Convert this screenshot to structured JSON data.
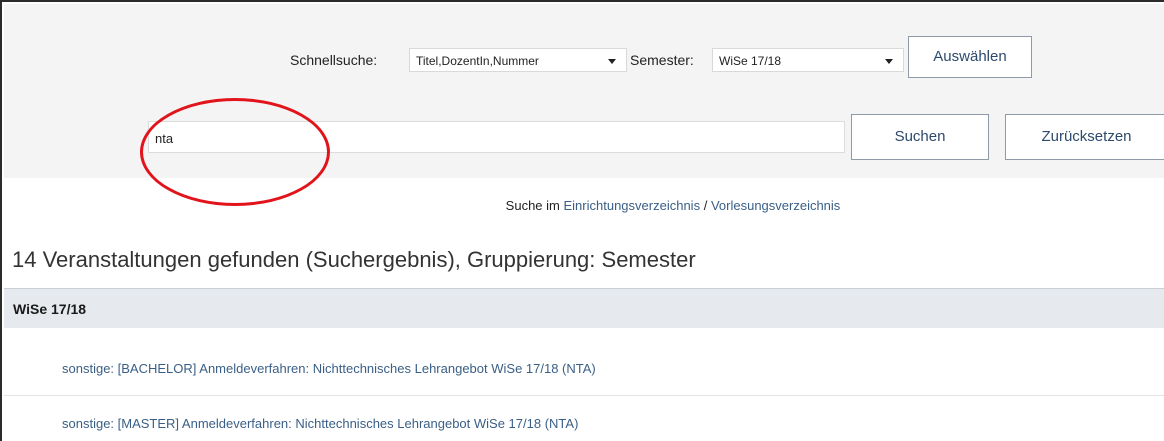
{
  "quick_search": {
    "label": "Schnellsuche:",
    "selected": "Titel,DozentIn,Nummer",
    "semester_label": "Semester:",
    "semester_selected": "WiSe 17/18",
    "select_button": "Auswählen"
  },
  "search": {
    "query": "nta",
    "search_button": "Suchen",
    "reset_button": "Zurücksetzen"
  },
  "directory": {
    "prefix": "Suche im",
    "link_institutions": "Einrichtungsverzeichnis",
    "separator": "/",
    "link_courses": "Vorlesungsverzeichnis"
  },
  "results": {
    "title": "14 Veranstaltungen gefunden (Suchergebnis), Gruppierung: Semester",
    "group": "WiSe 17/18",
    "items": [
      "sonstige: [BACHELOR] Anmeldeverfahren: Nichttechnisches Lehrangebot WiSe 17/18 (NTA)",
      "sonstige: [MASTER] Anmeldeverfahren: Nichttechnisches Lehrangebot WiSe 17/18 (NTA)"
    ]
  },
  "annotation": {
    "color": "#e2141b"
  }
}
